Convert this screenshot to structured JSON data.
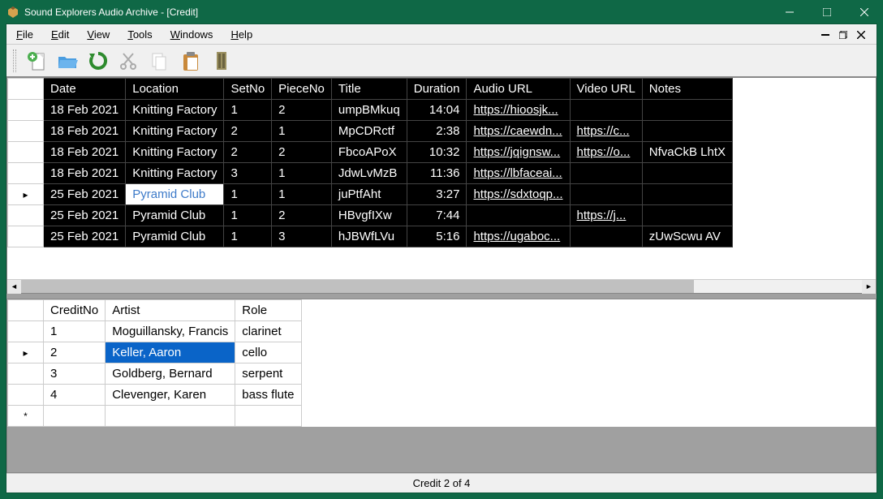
{
  "window": {
    "title": "Sound Explorers Audio Archive - [Credit]"
  },
  "menu": {
    "file": "File",
    "edit": "Edit",
    "view": "View",
    "tools": "Tools",
    "windows": "Windows",
    "help": "Help"
  },
  "toolbar_icons": {
    "new": "new-entry-icon",
    "open": "open-folder-icon",
    "refresh": "refresh-icon",
    "cut": "cut-icon",
    "copy": "copy-icon",
    "paste": "paste-icon",
    "filter": "filter-icon"
  },
  "top_headers": [
    "Date",
    "Location",
    "SetNo",
    "PieceNo",
    "Title",
    "Duration",
    "Audio URL",
    "Video URL",
    "Notes"
  ],
  "top_rows": [
    {
      "date": "18 Feb 2021",
      "location": "Knitting Factory",
      "setno": "1",
      "pieceno": "2",
      "title": "umpBMkuq",
      "duration": "14:04",
      "audio": "https://hioosjk...",
      "video": "",
      "notes": ""
    },
    {
      "date": "18 Feb 2021",
      "location": "Knitting Factory",
      "setno": "2",
      "pieceno": "1",
      "title": "MpCDRctf",
      "duration": "2:38",
      "audio": "https://caewdn...",
      "video": "https://c...",
      "notes": ""
    },
    {
      "date": "18 Feb 2021",
      "location": "Knitting Factory",
      "setno": "2",
      "pieceno": "2",
      "title": "FbcoAPoX",
      "duration": "10:32",
      "audio": "https://jqignsw...",
      "video": "https://o...",
      "notes": "NfvaCkB LhtX"
    },
    {
      "date": "18 Feb 2021",
      "location": "Knitting Factory",
      "setno": "3",
      "pieceno": "1",
      "title": "JdwLvMzB",
      "duration": "11:36",
      "audio": "https://lbfaceai...",
      "video": "",
      "notes": ""
    },
    {
      "date": "25 Feb 2021",
      "location": "Pyramid Club",
      "setno": "1",
      "pieceno": "1",
      "title": "juPtfAht",
      "duration": "3:27",
      "audio": "https://sdxtoqp...",
      "video": "",
      "notes": "",
      "selected": true
    },
    {
      "date": "25 Feb 2021",
      "location": "Pyramid Club",
      "setno": "1",
      "pieceno": "2",
      "title": "HBvgfIXw",
      "duration": "7:44",
      "audio": "",
      "video": "https://j...",
      "notes": ""
    },
    {
      "date": "25 Feb 2021",
      "location": "Pyramid Club",
      "setno": "1",
      "pieceno": "3",
      "title": "hJBWfLVu",
      "duration": "5:16",
      "audio": "https://ugaboc...",
      "video": "",
      "notes": "zUwScwu AV"
    }
  ],
  "bottom_headers": [
    "CreditNo",
    "Artist",
    "Role"
  ],
  "bottom_rows": [
    {
      "creditno": "1",
      "artist": "Moguillansky, Francis",
      "role": "clarinet"
    },
    {
      "creditno": "2",
      "artist": "Keller, Aaron",
      "role": "cello",
      "selected": true
    },
    {
      "creditno": "3",
      "artist": "Goldberg, Bernard",
      "role": "serpent"
    },
    {
      "creditno": "4",
      "artist": "Clevenger, Karen",
      "role": "bass flute"
    }
  ],
  "status": "Credit 2 of 4"
}
